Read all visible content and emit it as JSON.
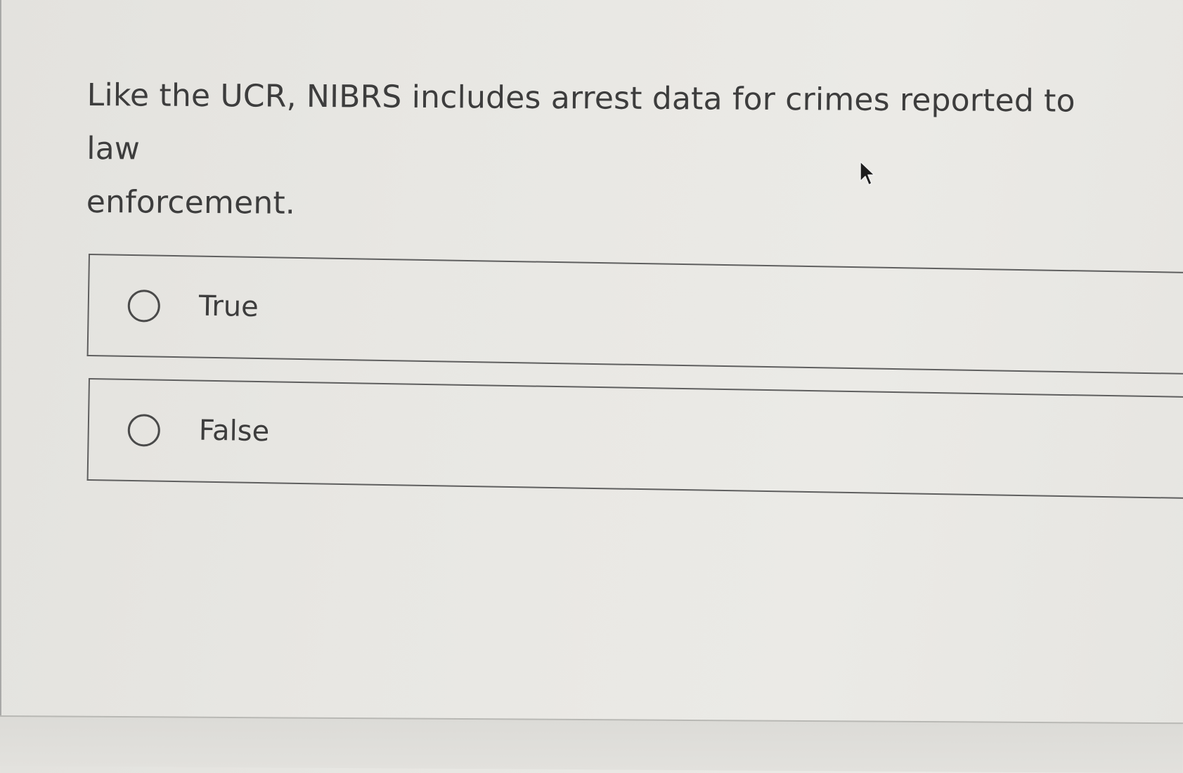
{
  "question": {
    "line1": "Like the UCR, NIBRS includes arrest data for crimes reported to law",
    "line2": "enforcement."
  },
  "options": [
    {
      "label": "True",
      "selected": false
    },
    {
      "label": "False",
      "selected": false
    }
  ],
  "icons": {
    "radio": "radio-circle-icon",
    "cursor": "mouse-pointer-icon"
  },
  "colors": {
    "background": "#e8e7e3",
    "text": "#3d3d3d",
    "border": "#5f5f5f"
  }
}
